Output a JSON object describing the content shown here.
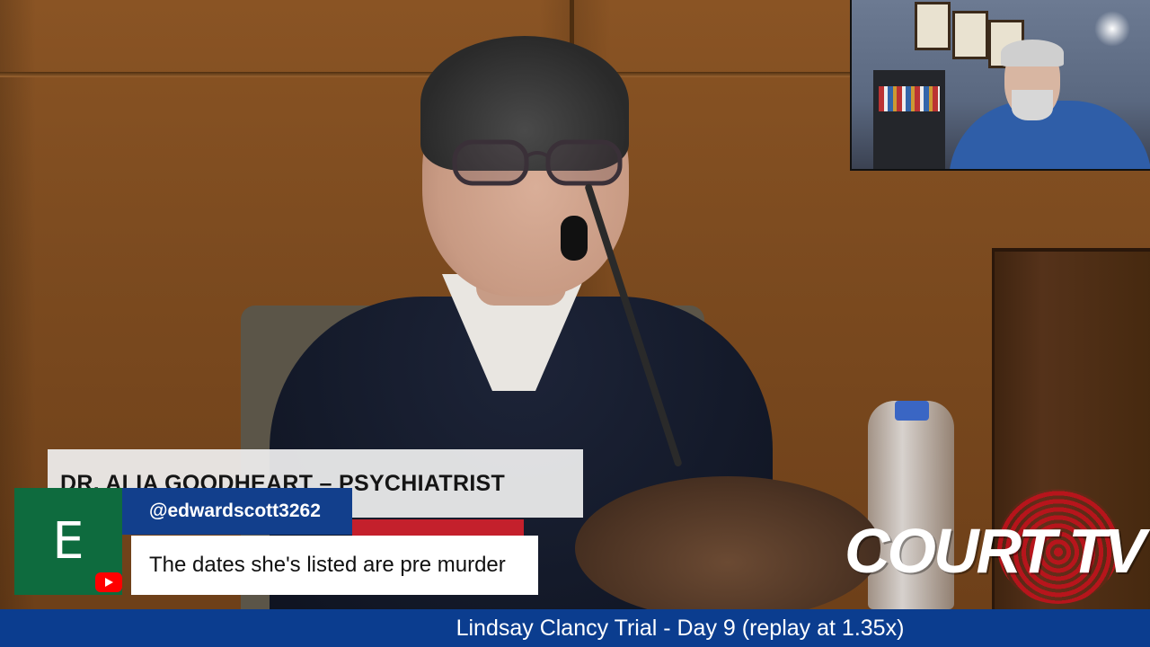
{
  "lower_third": {
    "title": "DR. ALIA GOODHEART – PSYCHIATRIST"
  },
  "chat": {
    "avatar_letter": "E",
    "username": "@edwardscott3262",
    "message": "The dates she's listed are pre murder",
    "platform_icon": "youtube-icon"
  },
  "logo": {
    "brand": "COURT TV"
  },
  "banner": {
    "text": "Lindsay Clancy Trial - Day 9 (replay at 1.35x)"
  },
  "colors": {
    "banner_bg": "#0b3d8f",
    "username_bg": "#123f8c",
    "avatar_bg": "#0e6b3e",
    "accent_red": "#c4202c"
  }
}
